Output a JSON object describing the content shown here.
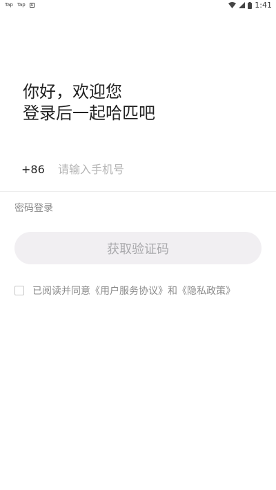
{
  "status_bar": {
    "left_items": [
      "Tap",
      "Tap"
    ],
    "time": "1:41"
  },
  "greeting": {
    "line1": "你好，欢迎您",
    "line2": "登录后一起哈匹吧"
  },
  "phone": {
    "country_code": "+86",
    "placeholder": "请输入手机号",
    "value": ""
  },
  "password_login_label": "密码登录",
  "get_code_button_label": "获取验证码",
  "agreement": {
    "checked": false,
    "prefix": "已阅读并同意",
    "user_agreement": "《用户服务协议》",
    "connector": "和",
    "privacy_policy": "《隐私政策》"
  },
  "colors": {
    "button_bg": "#f1eff2",
    "button_text": "#a9a9ac",
    "placeholder": "#b5b5b5",
    "secondary_text": "#8a8a8a"
  }
}
